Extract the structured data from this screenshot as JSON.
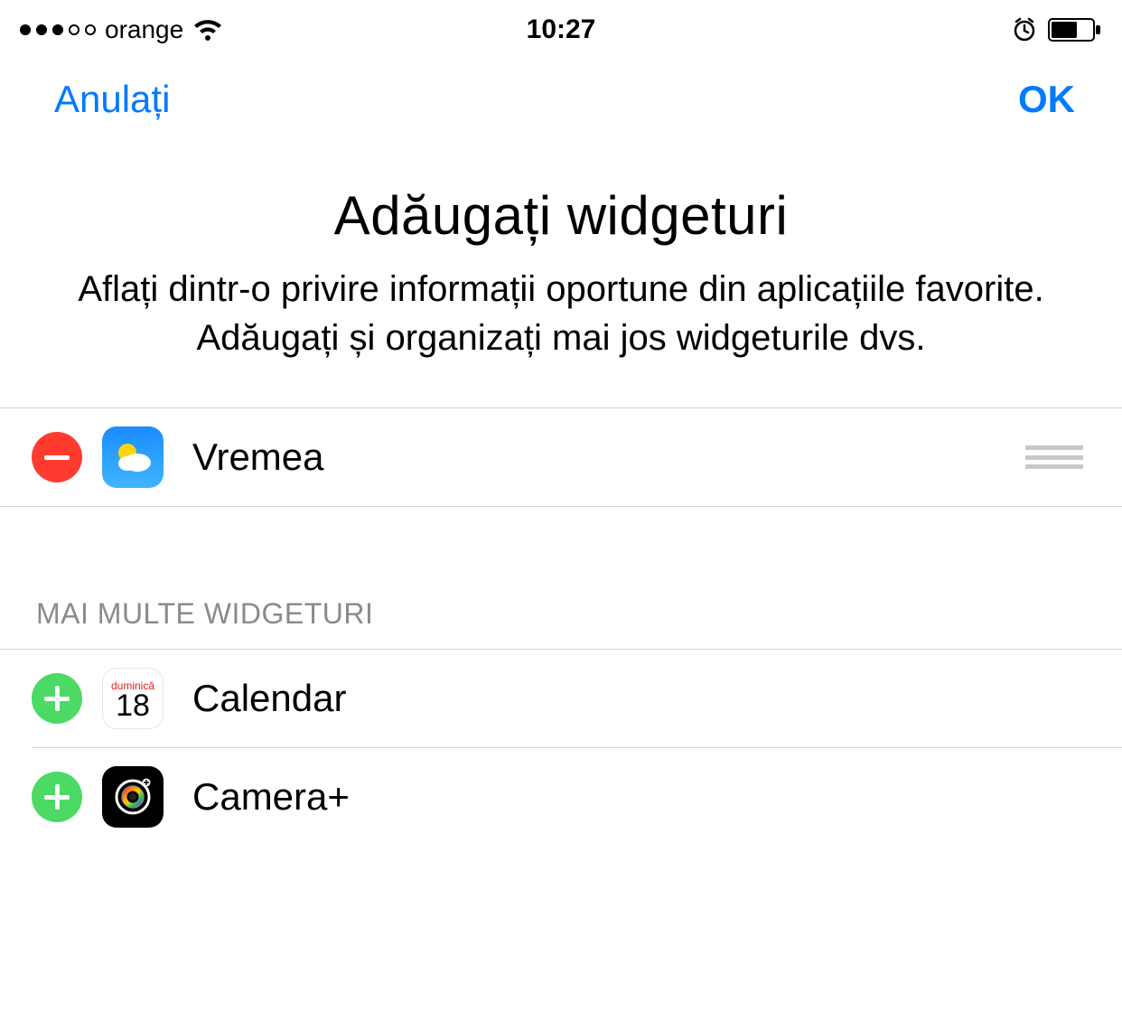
{
  "status": {
    "carrier": "orange",
    "time": "10:27"
  },
  "nav": {
    "cancel": "Anulați",
    "ok": "OK"
  },
  "header": {
    "title": "Adăugați widgeturi",
    "subtitle": "Aflați dintr-o privire informații oportune din aplicațiile favorite. Adăugați și organizați mai jos widgeturile dvs."
  },
  "active": {
    "items": [
      {
        "label": "Vremea",
        "icon": "weather"
      }
    ]
  },
  "more": {
    "section_label": "MAI MULTE WIDGETURI",
    "items": [
      {
        "label": "Calendar",
        "icon": "calendar",
        "cal_day_name": "duminică",
        "cal_day_num": "18"
      },
      {
        "label": "Camera+",
        "icon": "camera-plus"
      }
    ]
  }
}
